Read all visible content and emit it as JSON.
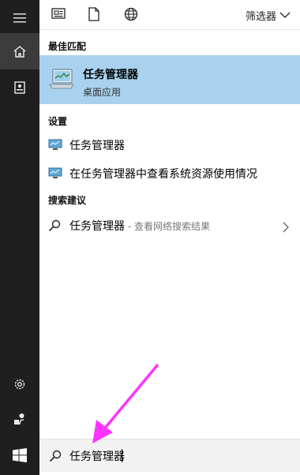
{
  "toolbar": {
    "filter_label": "筛选器",
    "icons": [
      "document-view-icon",
      "document-icon",
      "globe-icon"
    ]
  },
  "rail": {
    "icons": [
      "hamburger-menu-icon",
      "home-icon",
      "notebook-icon",
      "settings-gear-icon",
      "feedback-icon",
      "windows-start-icon"
    ]
  },
  "sections": {
    "best_match": "最佳匹配",
    "settings": "设置",
    "suggestions": "搜索建议"
  },
  "best_match": {
    "title": "任务管理器",
    "subtitle": "桌面应用"
  },
  "settings_items": [
    {
      "label": "任务管理器"
    },
    {
      "label": "在任务管理器中查看系统资源使用情况"
    }
  ],
  "suggestion": {
    "label": "任务管理器",
    "hint": " - 查看网络搜索结果"
  },
  "search": {
    "value": "任务管理器"
  },
  "colors": {
    "rail": "#1f1f1f",
    "rail_active": "#3b3b3b",
    "best_match_bg": "#a8d2ee",
    "annotation_arrow": "#ff33ff"
  }
}
